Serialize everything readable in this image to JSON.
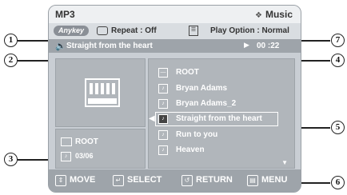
{
  "header": {
    "title": "MP3",
    "mode": "Music"
  },
  "status": {
    "anykey": "Anykey",
    "repeat": "Repeat : Off",
    "play_option": "Play Option : Normal"
  },
  "now_playing": {
    "track": "Straight from the heart",
    "time": "00 :22"
  },
  "info": {
    "folder": "ROOT",
    "track_count": "03/06"
  },
  "file_list": {
    "items": [
      {
        "label": "ROOT",
        "icon": "folder-icon"
      },
      {
        "label": "Bryan Adams",
        "icon": "music-file-icon"
      },
      {
        "label": "Bryan Adams_2",
        "icon": "music-file-icon"
      },
      {
        "label": "Straight from the heart",
        "icon": "music-file-icon",
        "selected": true
      },
      {
        "label": "Run to you",
        "icon": "music-file-icon"
      },
      {
        "label": "Heaven",
        "icon": "music-file-icon"
      }
    ]
  },
  "footer": {
    "move": "MOVE",
    "select": "SELECT",
    "return": "RETURN",
    "menu": "MENU"
  },
  "callouts": [
    "1",
    "2",
    "3",
    "4",
    "5",
    "6",
    "7"
  ]
}
